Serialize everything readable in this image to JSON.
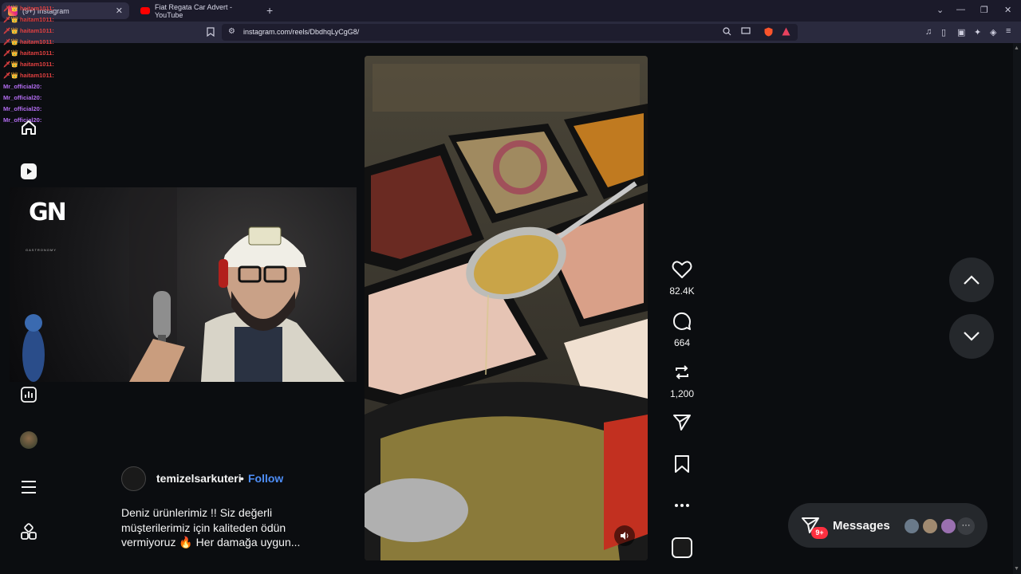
{
  "browser": {
    "tabs": [
      {
        "label": "(9+) Instagram",
        "active": true
      },
      {
        "label": "Fiat Regata Car Advert - YouTube",
        "active": false
      }
    ],
    "new_tab": "+",
    "url": "instagram.com/reels/DbdhqLyCgG8/"
  },
  "chat": {
    "lines": [
      {
        "user": "haitam1011:",
        "color": "red"
      },
      {
        "user": "haitam1011:",
        "color": "red"
      },
      {
        "user": "haitam1011:",
        "color": "red"
      },
      {
        "user": "haitam1011:",
        "color": "red"
      },
      {
        "user": "haitam1011:",
        "color": "red"
      },
      {
        "user": "haitam1011:",
        "color": "red"
      },
      {
        "user": "haitam1011:",
        "color": "red"
      },
      {
        "user": "Mr_official20:",
        "color": "purple"
      },
      {
        "user": "Mr_official20:",
        "color": "purple"
      },
      {
        "user": "Mr_official20:",
        "color": "purple"
      },
      {
        "user": "Mr_official20:",
        "color": "purple"
      }
    ]
  },
  "webcam": {
    "logo": "GN",
    "logo_sub": "GASTRONOMY"
  },
  "post": {
    "author": "temizelsarkuteri",
    "separator": "•",
    "follow": "Follow",
    "caption": "Deniz ürünlerimiz !! Siz değerli müşterilerimiz için kaliteden ödün vermiyoruz 🔥 Her damağa uygun..."
  },
  "actions": {
    "likes": "82.4K",
    "comments": "664",
    "reposts": "1,200"
  },
  "messages": {
    "label": "Messages",
    "badge": "9+"
  },
  "colors": {
    "accent": "#4e8ef7",
    "badge": "#ff3040",
    "background": "#0b0d10"
  }
}
